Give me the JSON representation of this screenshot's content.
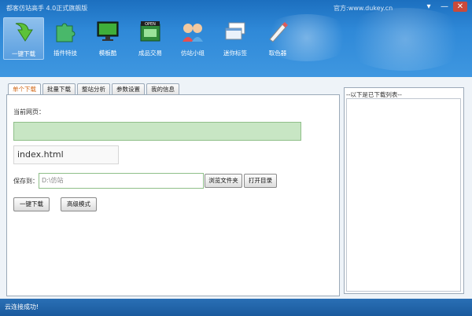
{
  "window": {
    "title": "都客仿站高手 4.0正式旗舰版",
    "site": "官方:www.dukey.cn",
    "controls": [
      "▾",
      "—",
      "✕"
    ]
  },
  "toolbar": [
    {
      "label": "一键下载",
      "icon": "download-arrow-icon",
      "active": true
    },
    {
      "label": "插件特技",
      "icon": "puzzle-icon",
      "active": false
    },
    {
      "label": "模板酷",
      "icon": "monitor-icon",
      "active": false
    },
    {
      "label": "成品交易",
      "icon": "open-shop-icon",
      "active": false
    },
    {
      "label": "仿站小组",
      "icon": "team-icon",
      "active": false
    },
    {
      "label": "迷你标签",
      "icon": "windows-icon",
      "active": false
    },
    {
      "label": "取色器",
      "icon": "color-picker-icon",
      "active": false
    }
  ],
  "tabs": [
    "单个下载",
    "批量下载",
    "整站分析",
    "参数设置",
    "我的信息"
  ],
  "form": {
    "url_label": "当前网页：",
    "url_value": "",
    "file_name": "index.html",
    "save_label": "保存到：",
    "save_path": "D:\\仿站",
    "browse_label": "浏览文件夹",
    "open_dir_label": "打开目录",
    "download_label": "一键下载",
    "advanced_label": "高级模式"
  },
  "right_panel": {
    "header": "--以下是已下载列表--"
  },
  "status": {
    "text": "云连接成功!"
  }
}
